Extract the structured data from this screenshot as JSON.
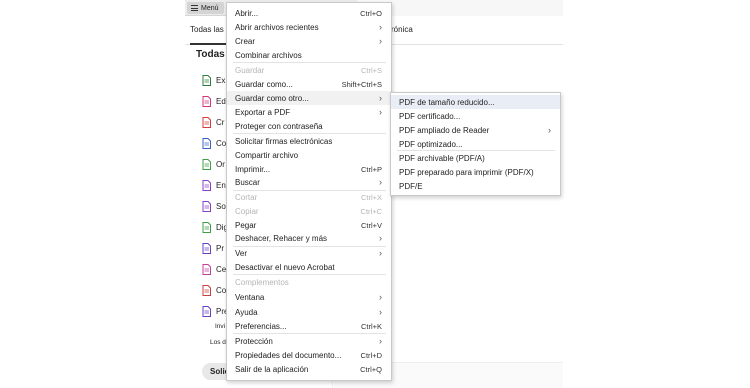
{
  "app": {
    "menu_button_label": "Menú",
    "tab_left": "Todas las",
    "tab_right": "rónica",
    "section_title": "Todas l",
    "side_items": [
      {
        "label": "Ex",
        "icon": "export-pdf-icon",
        "color": "#2d7d3a"
      },
      {
        "label": "Ed",
        "icon": "edit-pdf-icon",
        "color": "#d4367a"
      },
      {
        "label": "Cr",
        "icon": "create-pdf-icon",
        "color": "#d43b3b"
      },
      {
        "label": "Co",
        "icon": "combine-files-icon",
        "color": "#3a63c8"
      },
      {
        "label": "Or",
        "icon": "organize-pages-icon",
        "color": "#3f9d45"
      },
      {
        "label": "En",
        "icon": "send-icon",
        "color": "#8a3fc8"
      },
      {
        "label": "So",
        "icon": "sign-icon",
        "color": "#8a3fc8"
      },
      {
        "label": "Dig",
        "icon": "scan-icon",
        "color": "#3f9d45"
      },
      {
        "label": "Pr",
        "icon": "protect-icon",
        "color": "#6a3fc8"
      },
      {
        "label": "Ce",
        "icon": "certificate-icon",
        "color": "#c83f9a"
      },
      {
        "label": "Co",
        "icon": "compare-icon",
        "color": "#c83f3f"
      },
      {
        "label": "Pre",
        "icon": "prepare-form-icon",
        "color": "#6a3fc8"
      }
    ],
    "sub_items": [
      "Invi",
      "Los d"
    ],
    "bottom_button": "Solic"
  },
  "menu": {
    "items": [
      {
        "label": "Abrir...",
        "shortcut": "Ctrl+O",
        "submenu": false,
        "disabled": false
      },
      {
        "label": "Abrir archivos recientes",
        "shortcut": "",
        "submenu": true,
        "disabled": false
      },
      {
        "label": "Crear",
        "shortcut": "",
        "submenu": true,
        "disabled": false
      },
      {
        "label": "Combinar archivos",
        "shortcut": "",
        "submenu": false,
        "disabled": false
      },
      {
        "label": "Guardar",
        "shortcut": "Ctrl+S",
        "submenu": false,
        "disabled": true
      },
      {
        "label": "Guardar como...",
        "shortcut": "Shift+Ctrl+S",
        "submenu": false,
        "disabled": false
      },
      {
        "label": "Guardar como otro...",
        "shortcut": "",
        "submenu": true,
        "disabled": false
      },
      {
        "label": "Exportar a PDF",
        "shortcut": "",
        "submenu": true,
        "disabled": false
      },
      {
        "label": "Proteger con contraseña",
        "shortcut": "",
        "submenu": false,
        "disabled": false
      },
      {
        "label": "Solicitar firmas electrónicas",
        "shortcut": "",
        "submenu": false,
        "disabled": false
      },
      {
        "label": "Compartir archivo",
        "shortcut": "",
        "submenu": false,
        "disabled": false
      },
      {
        "label": "Imprimir...",
        "shortcut": "Ctrl+P",
        "submenu": false,
        "disabled": false
      },
      {
        "label": "Buscar",
        "shortcut": "",
        "submenu": true,
        "disabled": false
      },
      {
        "label": "Cortar",
        "shortcut": "Ctrl+X",
        "submenu": false,
        "disabled": true
      },
      {
        "label": "Copiar",
        "shortcut": "Ctrl+C",
        "submenu": false,
        "disabled": true
      },
      {
        "label": "Pegar",
        "shortcut": "Ctrl+V",
        "submenu": false,
        "disabled": false
      },
      {
        "label": "Deshacer, Rehacer y más",
        "shortcut": "",
        "submenu": true,
        "disabled": false
      },
      {
        "label": "Ver",
        "shortcut": "",
        "submenu": true,
        "disabled": false
      },
      {
        "label": "Desactivar el nuevo Acrobat",
        "shortcut": "",
        "submenu": false,
        "disabled": false
      },
      {
        "label": "Complementos",
        "shortcut": "",
        "submenu": false,
        "disabled": true
      },
      {
        "label": "Ventana",
        "shortcut": "",
        "submenu": true,
        "disabled": false
      },
      {
        "label": "Ayuda",
        "shortcut": "",
        "submenu": true,
        "disabled": false
      },
      {
        "label": "Preferencias...",
        "shortcut": "Ctrl+K",
        "submenu": false,
        "disabled": false
      },
      {
        "label": "Protección",
        "shortcut": "",
        "submenu": true,
        "disabled": false
      },
      {
        "label": "Propiedades del documento...",
        "shortcut": "Ctrl+D",
        "submenu": false,
        "disabled": false
      },
      {
        "label": "Salir de la aplicación",
        "shortcut": "Ctrl+Q",
        "submenu": false,
        "disabled": false
      }
    ]
  },
  "submenu": {
    "items": [
      {
        "label": "PDF de tamaño reducido...",
        "submenu": false
      },
      {
        "label": "PDF certificado...",
        "submenu": false
      },
      {
        "label": "PDF ampliado de Reader",
        "submenu": true
      },
      {
        "label": "PDF optimizado...",
        "submenu": false
      },
      {
        "label": "PDF archivable (PDF/A)",
        "submenu": false
      },
      {
        "label": "PDF preparado para imprimir (PDF/X)",
        "submenu": false
      },
      {
        "label": "PDF/E",
        "submenu": false
      }
    ]
  },
  "colors": {
    "menu_highlight": "#f1f1f1",
    "submenu_highlight": "#e9eef6",
    "disabled_text": "#b5b5b5"
  }
}
